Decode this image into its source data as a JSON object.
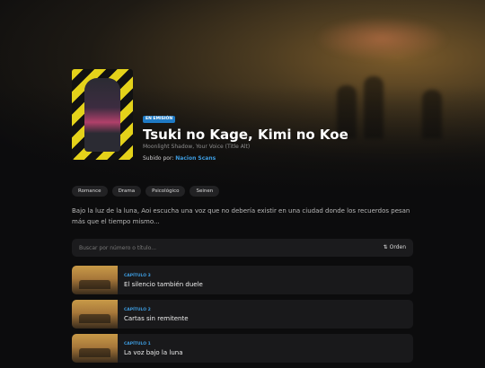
{
  "series": {
    "status_badge": "EN EMISIÓN",
    "title": "Tsuki no Kage, Kimi no Koe",
    "alt_title": "Moonlight Shadow, Your Voice (Title Alt)",
    "uploaded_by_label": "Subido por:",
    "uploader": "Nacion Scans",
    "tags": [
      "Romance",
      "Drama",
      "Psicológico",
      "Seinen"
    ],
    "synopsis": "Bajo la luz de la luna, Aoi escucha una voz que no debería existir en una ciudad donde los recuerdos pesan más que el tiempo mismo..."
  },
  "search": {
    "placeholder": "Buscar por número o título...",
    "sort_label": "Orden",
    "sort_icon": "sort-icon"
  },
  "chapters": [
    {
      "number": "CAPÍTULO 3",
      "title": "El silencio también duele"
    },
    {
      "number": "CAPÍTULO 2",
      "title": "Cartas sin remitente"
    },
    {
      "number": "CAPÍTULO 1",
      "title": "La voz bajo la luna"
    }
  ]
}
